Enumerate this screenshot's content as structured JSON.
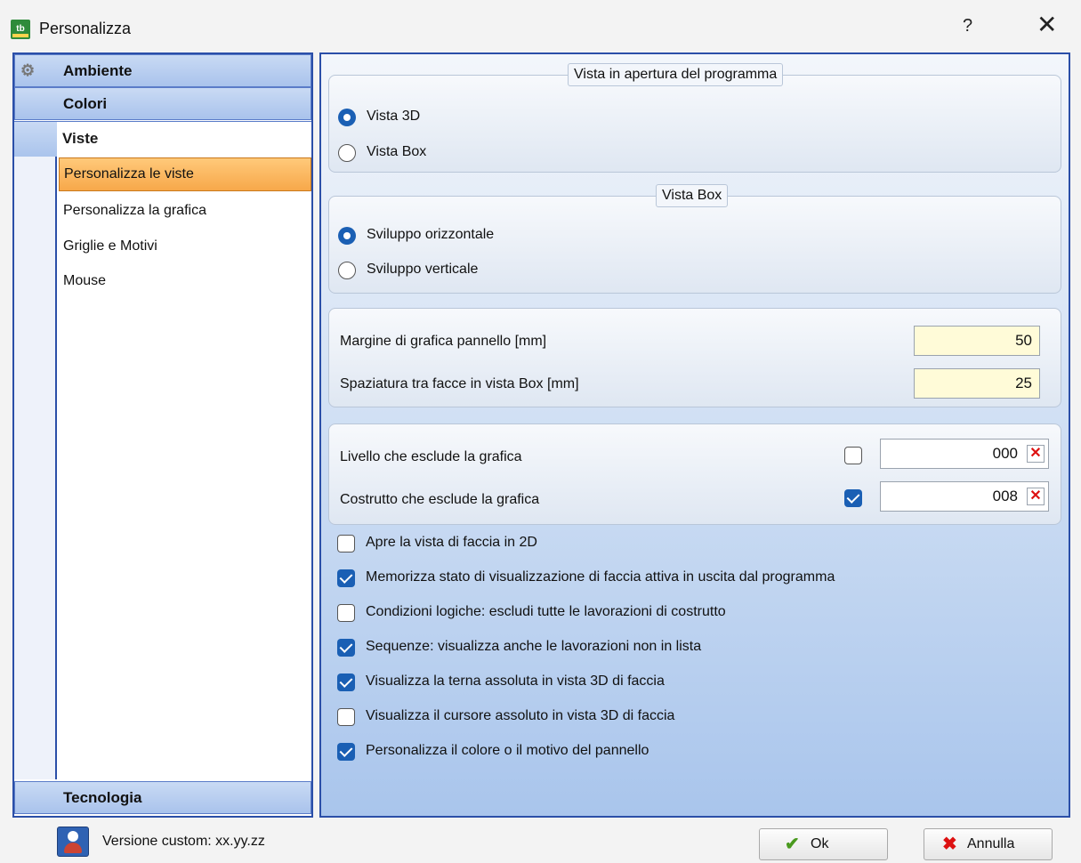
{
  "window": {
    "title": "Personalizza",
    "help_label": "?",
    "close_label": "✕",
    "app_icon_text": "tb"
  },
  "nav": {
    "ambiente": "Ambiente",
    "colori": "Colori",
    "viste": "Viste",
    "items": [
      {
        "label": "Personalizza le viste",
        "selected": true
      },
      {
        "label": "Personalizza la grafica",
        "selected": false
      },
      {
        "label": "Griglie e Motivi",
        "selected": false
      },
      {
        "label": "Mouse",
        "selected": false
      }
    ],
    "tecnologia": "Tecnologia"
  },
  "open_view": {
    "legend": "Vista in apertura del programma",
    "options": [
      {
        "label": "Vista 3D",
        "selected": true
      },
      {
        "label": "Vista Box",
        "selected": false
      }
    ]
  },
  "box_view": {
    "legend": "Vista Box",
    "options": [
      {
        "label": "Sviluppo orizzontale",
        "selected": true
      },
      {
        "label": "Sviluppo verticale",
        "selected": false
      }
    ]
  },
  "margins": {
    "panel_margin_label": "Margine di grafica pannello [mm]",
    "panel_margin_value": "50",
    "face_spacing_label": "Spaziatura tra facce in vista Box [mm]",
    "face_spacing_value": "25"
  },
  "exclusions": {
    "level_label": "Livello che esclude la grafica",
    "level_checked": false,
    "level_value": "000",
    "construct_label": "Costrutto che esclude la grafica",
    "construct_checked": true,
    "construct_value": "008",
    "clear_glyph": "✕"
  },
  "options": [
    {
      "label": "Apre la vista di faccia in 2D",
      "checked": false
    },
    {
      "label": "Memorizza stato di visualizzazione di faccia attiva in uscita dal programma",
      "checked": true
    },
    {
      "label": "Condizioni logiche: escludi tutte le lavorazioni di costrutto",
      "checked": false
    },
    {
      "label": "Sequenze: visualizza anche le lavorazioni non in lista",
      "checked": true
    },
    {
      "label": "Visualizza la terna assoluta in vista 3D di faccia",
      "checked": true
    },
    {
      "label": "Visualizza il cursore assoluto in vista 3D di faccia",
      "checked": false
    },
    {
      "label": "Personalizza il colore o il motivo del pannello",
      "checked": true
    }
  ],
  "footer": {
    "version": "Versione custom: xx.yy.zz",
    "ok_label": "Ok",
    "cancel_label": "Annulla",
    "ok_glyph": "✔",
    "cancel_glyph": "✖"
  }
}
